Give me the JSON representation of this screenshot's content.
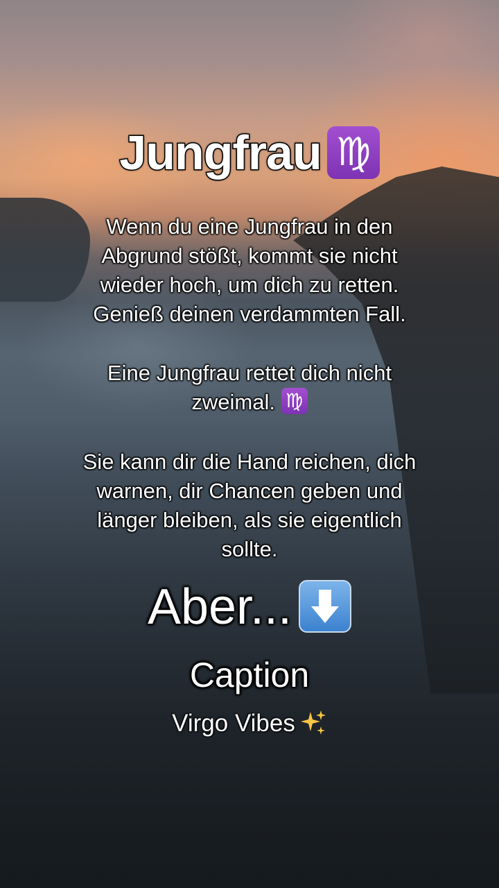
{
  "post": {
    "title": "Jungfrau",
    "title_icon": "virgo-zodiac-icon",
    "paragraphs": {
      "p1": [
        "Wenn du eine Jungfrau in den",
        "Abgrund stößt, kommt sie nicht",
        "wieder hoch, um dich zu retten.",
        "Genieß deinen verdammten Fall."
      ],
      "p2": [
        "Eine Jungfrau rettet dich nicht",
        "zweimal."
      ],
      "p3": [
        "Sie kann dir die Hand reichen, dich",
        "warnen, dir Chancen geben und",
        "länger bleiben, als sie eigentlich",
        "sollte."
      ]
    },
    "emphasis": "Aber...",
    "emphasis_icon": "down-arrow-icon",
    "caption_heading": "Caption",
    "caption_text": "Virgo Vibes",
    "caption_icon": "sparkles-icon"
  },
  "colors": {
    "virgo_badge": "#8e3fc4",
    "arrow_badge": "#4f8fd8",
    "sparkle": "#f6c544"
  }
}
